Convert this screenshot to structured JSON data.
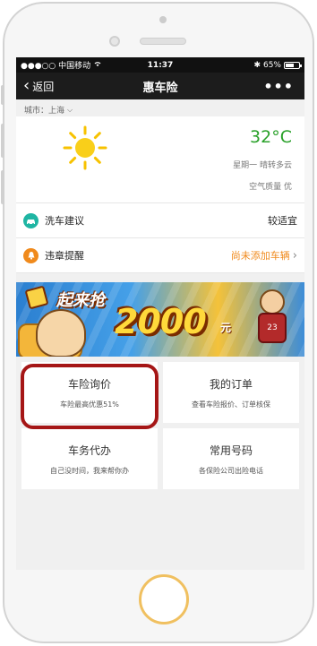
{
  "status": {
    "carrier": "●●●○○ 中国移动",
    "time": "11:37",
    "battery": "65%",
    "battery_level": 0.65
  },
  "nav": {
    "back_label": "返回",
    "title": "惠车险",
    "more_label": "•••"
  },
  "city": {
    "label": "城市：上海"
  },
  "weather": {
    "temperature": "32°C",
    "condition": "星期一 晴转多云",
    "air_quality": "空气质量 优",
    "icon": "sun-icon"
  },
  "rows": [
    {
      "label": "洗车建议",
      "value": "较适宜",
      "icon": "car-wash-icon",
      "icon_color": "#1fb5a3"
    },
    {
      "label": "违章提醒",
      "value": "尚未添加车辆",
      "icon": "bell-icon",
      "icon_color": "#f08a1c"
    }
  ],
  "banner": {
    "text_main": "起来抢",
    "text_amount": "2000",
    "text_unit": "元",
    "jersey_number": "23"
  },
  "cards": [
    {
      "title": "车险询价",
      "subtitle": "车险最高优惠51%"
    },
    {
      "title": "我的订单",
      "subtitle": "查看车险报价、订单核保"
    },
    {
      "title": "车务代办",
      "subtitle": "自己没时间，我来帮你办"
    },
    {
      "title": "常用号码",
      "subtitle": "各保险公司出险电话"
    }
  ],
  "colors": {
    "temperature": "#2aa12a",
    "accent_orange": "#f08a1c",
    "highlight_border": "#a51616"
  }
}
